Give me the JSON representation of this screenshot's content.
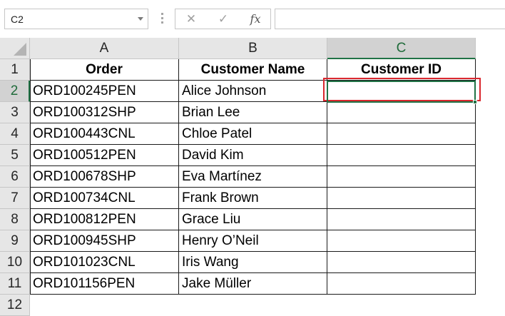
{
  "formula_bar": {
    "name_box": "C2",
    "cancel_glyph": "✕",
    "enter_glyph": "✓",
    "fx_glyph": "fx",
    "formula_value": ""
  },
  "columns": [
    {
      "label": "A"
    },
    {
      "label": "B"
    },
    {
      "label": "C"
    }
  ],
  "rows": [
    {
      "num": "1",
      "cells": [
        "Order",
        "Customer Name",
        "Customer ID"
      ]
    },
    {
      "num": "2",
      "cells": [
        "ORD100245PEN",
        "Alice Johnson",
        ""
      ]
    },
    {
      "num": "3",
      "cells": [
        "ORD100312SHP",
        "Brian Lee",
        ""
      ]
    },
    {
      "num": "4",
      "cells": [
        "ORD100443CNL",
        "Chloe Patel",
        ""
      ]
    },
    {
      "num": "5",
      "cells": [
        "ORD100512PEN",
        "David Kim",
        ""
      ]
    },
    {
      "num": "6",
      "cells": [
        "ORD100678SHP",
        "Eva Martínez",
        ""
      ]
    },
    {
      "num": "7",
      "cells": [
        "ORD100734CNL",
        "Frank Brown",
        ""
      ]
    },
    {
      "num": "8",
      "cells": [
        "ORD100812PEN",
        "Grace Liu",
        ""
      ]
    },
    {
      "num": "9",
      "cells": [
        "ORD100945SHP",
        "Henry O’Neil",
        ""
      ]
    },
    {
      "num": "10",
      "cells": [
        "ORD101023CNL",
        "Iris Wang",
        ""
      ]
    },
    {
      "num": "11",
      "cells": [
        "ORD101156PEN",
        "Jake Müller",
        ""
      ]
    },
    {
      "num": "12",
      "cells": [
        "",
        "",
        ""
      ]
    }
  ],
  "selection": {
    "active_cell": "C2",
    "accent_color": "#217346",
    "highlight_color": "#d9272e"
  },
  "icons": {
    "name_box_dropdown": "chevron-down-icon",
    "cancel": "close-icon",
    "enter": "checkmark-icon",
    "function": "fx-icon",
    "select_all": "select-all-icon"
  }
}
